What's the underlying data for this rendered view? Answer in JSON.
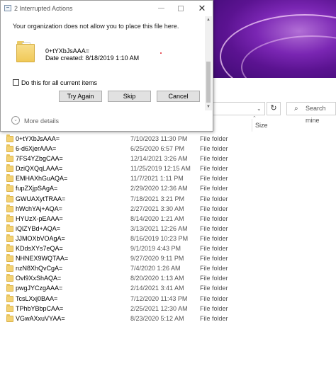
{
  "dialog": {
    "title": "2 Interrupted Actions",
    "message": "Your organization does not allow you to place this file here.",
    "file_name": "0+tYXbJsAAA=",
    "file_date": "Date created: 8/18/2019 1:10 AM",
    "checkbox_label": "Do this for all current items",
    "buttons": {
      "retry": "Try Again",
      "skip": "Skip",
      "cancel": "Cancel"
    },
    "more_details": "More details",
    "window_buttons": {
      "close": "✕"
    }
  },
  "explorer": {
    "search_placeholder": "Search mine",
    "columns": {
      "size": "Size"
    },
    "rows": [
      {
        "name": "0+tYXbJsAAA=",
        "date": "7/10/2023 11:30 PM",
        "type": "File folder"
      },
      {
        "name": "6-d6XjerAAA=",
        "date": "6/25/2020 6:57 PM",
        "type": "File folder"
      },
      {
        "name": "7FS4YZbgCAA=",
        "date": "12/14/2021 3:26 AM",
        "type": "File folder"
      },
      {
        "name": "DziQXQqLAAA=",
        "date": "11/25/2019 12:15 AM",
        "type": "File folder"
      },
      {
        "name": "EMHAXhGuAQA=",
        "date": "11/7/2021 1:11 PM",
        "type": "File folder"
      },
      {
        "name": "fupZXjpSAgA=",
        "date": "2/29/2020 12:36 AM",
        "type": "File folder"
      },
      {
        "name": "GWUAXytTRAA=",
        "date": "7/18/2021 3:21 PM",
        "type": "File folder"
      },
      {
        "name": "hWchYAj+AQA=",
        "date": "2/27/2021 3:30 AM",
        "type": "File folder"
      },
      {
        "name": "HYUzX-pEAAA=",
        "date": "8/14/2020 1:21 AM",
        "type": "File folder"
      },
      {
        "name": "iQlZYBd+AQA=",
        "date": "3/13/2021 12:26 AM",
        "type": "File folder"
      },
      {
        "name": "JJMOXbVOAgA=",
        "date": "8/16/2019 10:23 PM",
        "type": "File folder"
      },
      {
        "name": "KDdsXYs7eQA=",
        "date": "9/1/2019 4:43 PM",
        "type": "File folder"
      },
      {
        "name": "NHNEX9WQTAA=",
        "date": "9/27/2020 9:11 PM",
        "type": "File folder"
      },
      {
        "name": "nzN8XhQvCgA=",
        "date": "7/4/2020 1:26 AM",
        "type": "File folder"
      },
      {
        "name": "Ovl9XxShAQA=",
        "date": "8/20/2020 1:13 AM",
        "type": "File folder"
      },
      {
        "name": "pwgJYCzgAAA=",
        "date": "2/14/2021 3:41 AM",
        "type": "File folder"
      },
      {
        "name": "TcsLXxj0BAA=",
        "date": "7/12/2020 11:43 PM",
        "type": "File folder"
      },
      {
        "name": "TPhbYBbpCAA=",
        "date": "2/25/2021 12:30 AM",
        "type": "File folder"
      },
      {
        "name": "VGwAXxuVYAA=",
        "date": "8/23/2020 5:12 AM",
        "type": "File folder"
      }
    ]
  },
  "colors": {
    "wallpaper": "#6a1aa6",
    "folder": "#f4d272",
    "button": "#e1e1e1"
  },
  "icons": {
    "refresh": "↻",
    "search": "⌕"
  }
}
